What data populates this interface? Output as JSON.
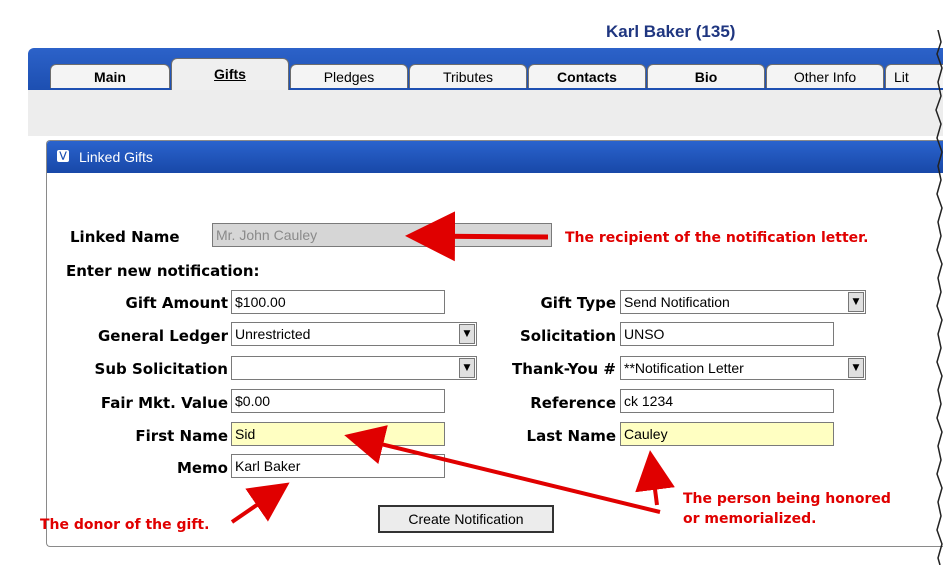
{
  "header": {
    "title": "Karl Baker (135)"
  },
  "tabs": [
    {
      "label": "Main"
    },
    {
      "label": "Gifts"
    },
    {
      "label": "Pledges"
    },
    {
      "label": "Tributes"
    },
    {
      "label": "Contacts"
    },
    {
      "label": "Bio"
    },
    {
      "label": "Other Info"
    },
    {
      "label": "Lit"
    }
  ],
  "panel": {
    "title": "Linked Gifts"
  },
  "form": {
    "linked_name_label": "Linked Name",
    "linked_name_value": "Mr. John Cauley",
    "section_label": "Enter new notification:",
    "gift_amount_label": "Gift Amount",
    "gift_amount_value": "$100.00",
    "gift_type_label": "Gift Type",
    "gift_type_value": "Send Notification",
    "general_ledger_label": "General Ledger",
    "general_ledger_value": "Unrestricted",
    "solicitation_label": "Solicitation",
    "solicitation_value": "UNSO",
    "sub_solicitation_label": "Sub Solicitation",
    "sub_solicitation_value": "",
    "thank_you_label": "Thank-You #",
    "thank_you_value": "**Notification Letter",
    "fair_mkt_label": "Fair Mkt. Value",
    "fair_mkt_value": "$0.00",
    "reference_label": "Reference",
    "reference_value": "ck 1234",
    "first_name_label": "First Name",
    "first_name_value": "Sid",
    "last_name_label": "Last Name",
    "last_name_value": "Cauley",
    "memo_label": "Memo",
    "memo_value": "Karl Baker",
    "create_button": "Create Notification"
  },
  "annotations": {
    "recipient": "The recipient of the notification letter.",
    "donor": "The donor of the gift.",
    "honored_line1": "The person being honored",
    "honored_line2": "or memorialized."
  },
  "colors": {
    "tab_bar": "#1d4fb1",
    "annotation": "#e00000",
    "highlight_field": "#ffffc2"
  }
}
